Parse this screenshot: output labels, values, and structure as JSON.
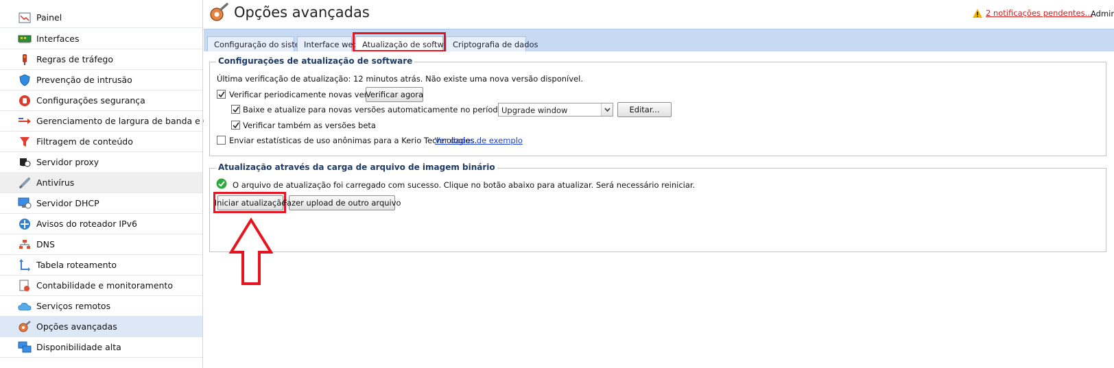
{
  "sidebar": {
    "items": [
      {
        "label": "Painel",
        "icon": "dashboard-icon"
      },
      {
        "label": "Interfaces",
        "icon": "network-card-icon"
      },
      {
        "label": "Regras de tráfego",
        "icon": "traffic-rules-icon"
      },
      {
        "label": "Prevenção de intrusão",
        "icon": "shield-icon"
      },
      {
        "label": "Configurações segurança",
        "icon": "stop-hand-icon"
      },
      {
        "label": "Gerenciamento de largura de banda e QoS",
        "icon": "bandwidth-arrow-icon"
      },
      {
        "label": "Filtragem de conteúdo",
        "icon": "funnel-icon"
      },
      {
        "label": "Servidor proxy",
        "icon": "proxy-server-icon"
      },
      {
        "label": "Antivírus",
        "icon": "syringe-icon"
      },
      {
        "label": "Servidor DHCP",
        "icon": "monitor-clock-icon"
      },
      {
        "label": "Avisos do roteador IPv6",
        "icon": "router-icon"
      },
      {
        "label": "DNS",
        "icon": "dns-tree-icon"
      },
      {
        "label": "Tabela roteamento",
        "icon": "routing-table-icon"
      },
      {
        "label": "Contabilidade e monitoramento",
        "icon": "report-icon"
      },
      {
        "label": "Serviços remotos",
        "icon": "cloud-icon"
      },
      {
        "label": "Opções avançadas",
        "icon": "gear-wrench-icon"
      },
      {
        "label": "Disponibilidade alta",
        "icon": "high-availability-icon"
      }
    ]
  },
  "header": {
    "title": "Opções avançadas",
    "notifications_link": "2 notificações pendentes...",
    "user": "Admin"
  },
  "tabs": [
    {
      "label": "Configuração do sistema"
    },
    {
      "label": "Interface web"
    },
    {
      "label": "Atualização de software"
    },
    {
      "label": "Criptografia de dados"
    }
  ],
  "update_settings": {
    "legend": "Configurações de atualização de software",
    "last_check": "Última verificação de atualização: 12 minutos atrás. Não existe uma nova versão disponível.",
    "periodic_check_label": "Verificar periodicamente novas versões",
    "periodic_check_checked": true,
    "check_now_button": "Verificar agora",
    "auto_download_label": "Baixe e atualize para novas versões automaticamente no período de tempo:",
    "auto_download_checked": true,
    "time_window_value": "Upgrade window",
    "edit_button": "Editar...",
    "beta_label": "Verificar também as versões beta",
    "beta_checked": true,
    "stats_label": "Enviar estatísticas de uso anônimas para a Kerio Technologies.",
    "stats_checked": false,
    "sample_link": "Ver dados de exemplo"
  },
  "binary_upload": {
    "legend": "Atualização através da carga de arquivo de imagem binário",
    "status_message": "O arquivo de atualização foi carregado com sucesso. Clique no botão abaixo para atualizar. Será necessário reiniciar.",
    "start_button": "Iniciar atualização",
    "upload_other_button": "Fazer upload de outro arquivo"
  },
  "colors": {
    "accent_band": "#c6dbf3",
    "highlight": "#e5141e",
    "link": "#1a3fd6",
    "legend_text": "#1d3a66"
  }
}
